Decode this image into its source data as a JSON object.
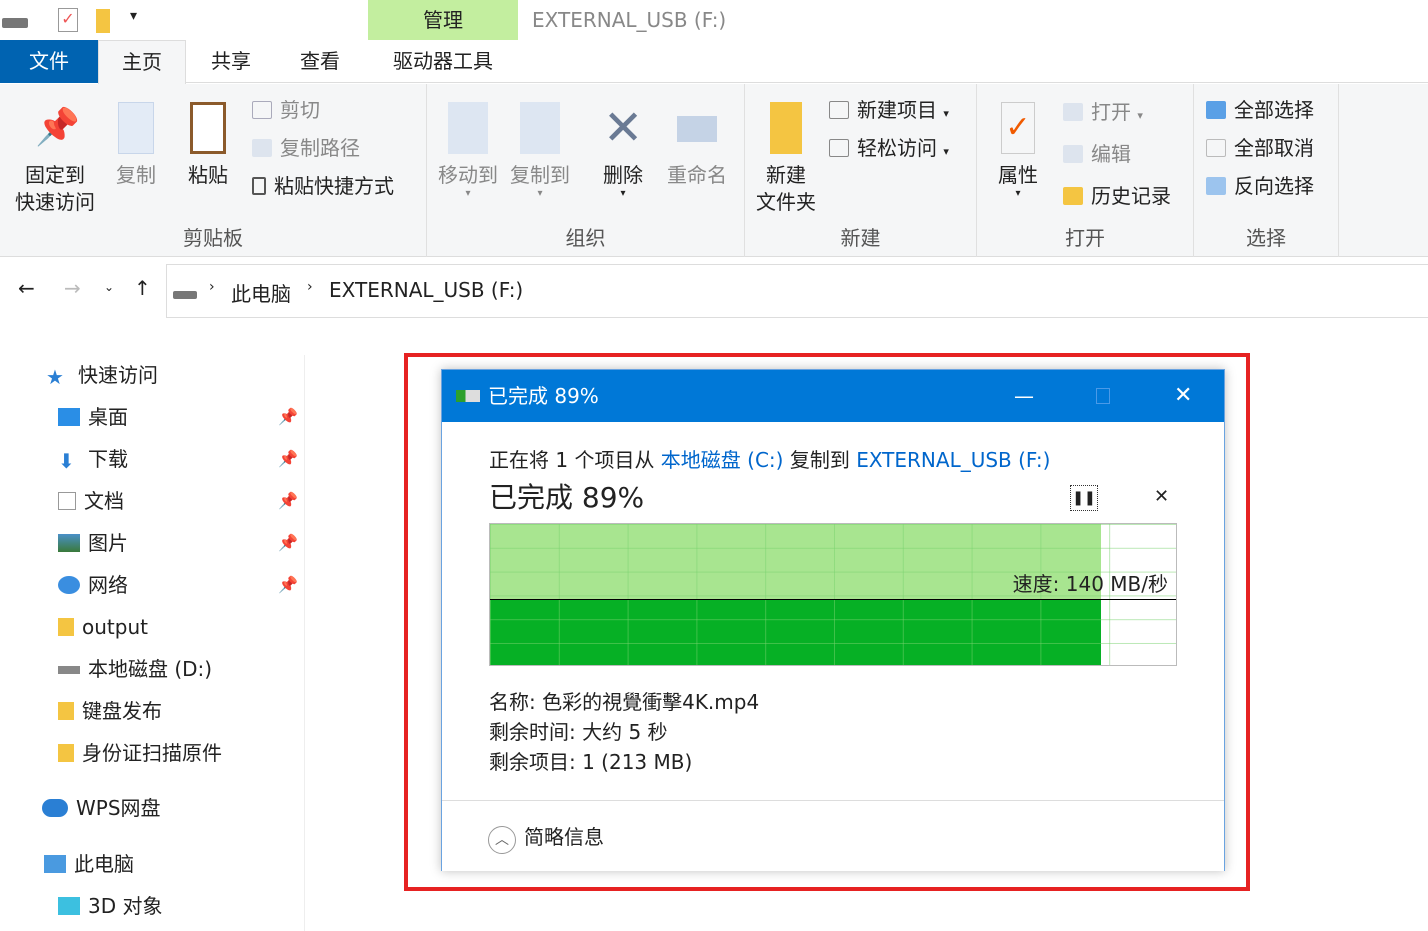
{
  "window": {
    "title": "EXTERNAL_USB (F:)",
    "context_tab": "管理"
  },
  "tabs": [
    "文件",
    "主页",
    "共享",
    "查看",
    "驱动器工具"
  ],
  "ribbon": {
    "clipboard": {
      "label": "剪贴板",
      "pin": "固定到",
      "pin2": "快速访问",
      "copy": "复制",
      "paste": "粘贴",
      "cut": "剪切",
      "copy_path": "复制路径",
      "paste_shortcut": "粘贴快捷方式"
    },
    "organize": {
      "label": "组织",
      "move_to": "移动到",
      "copy_to": "复制到",
      "delete": "删除",
      "rename": "重命名"
    },
    "new": {
      "label": "新建",
      "new_folder": "新建",
      "new_folder2": "文件夹",
      "new_item": "新建项目",
      "easy_access": "轻松访问"
    },
    "open": {
      "label": "打开",
      "properties": "属性",
      "open": "打开",
      "edit": "编辑",
      "history": "历史记录"
    },
    "select": {
      "label": "选择",
      "select_all": "全部选择",
      "select_none": "全部取消",
      "invert": "反向选择"
    }
  },
  "address": {
    "crumbs": [
      "此电脑",
      "EXTERNAL_USB (F:)"
    ]
  },
  "nav": {
    "items": [
      {
        "label": "快速访问",
        "pinned": false
      },
      {
        "label": "桌面",
        "pinned": true
      },
      {
        "label": "下载",
        "pinned": true
      },
      {
        "label": "文档",
        "pinned": true
      },
      {
        "label": "图片",
        "pinned": true
      },
      {
        "label": "网络",
        "pinned": true
      },
      {
        "label": "output",
        "pinned": false
      },
      {
        "label": "本地磁盘 (D:)",
        "pinned": false
      },
      {
        "label": "键盘发布",
        "pinned": false
      },
      {
        "label": "身份证扫描原件",
        "pinned": false
      },
      {
        "label": "WPS网盘",
        "pinned": false
      },
      {
        "label": "此电脑",
        "pinned": false
      },
      {
        "label": "3D 对象",
        "pinned": false
      }
    ]
  },
  "dialog": {
    "title": "已完成 89%",
    "desc_prefix": "正在将 1 个项目从 ",
    "source": "本地磁盘 (C:)",
    "desc_mid": " 复制到 ",
    "dest": "EXTERNAL_USB (F:)",
    "progress_label": "已完成 89%",
    "progress": 0.89,
    "speed": "速度: 140 MB/秒",
    "name": "名称: 色彩的視覺衝擊4K.mp4",
    "time_left": "剩余时间: 大约 5 秒",
    "items_left": "剩余项目: 1 (213 MB)",
    "less_details": "简略信息"
  },
  "colors": {
    "accent": "#0078d7",
    "progress_light": "#a8e590",
    "progress_dark": "#06b025",
    "highlight": "#e62222"
  }
}
